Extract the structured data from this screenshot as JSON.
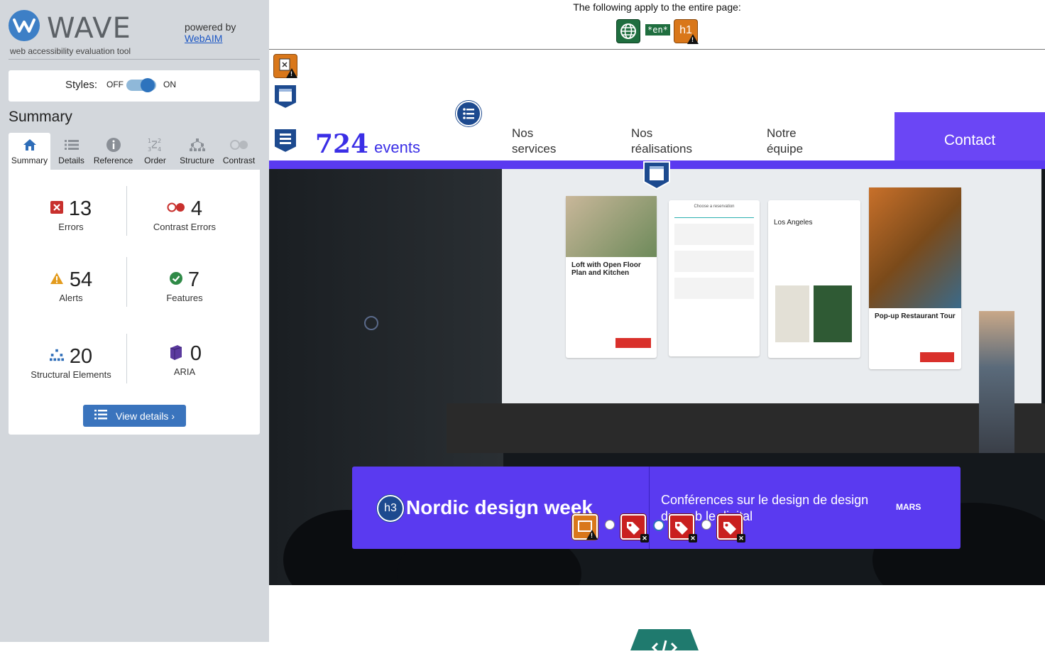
{
  "wave": {
    "brand": "WAVE",
    "subtitle": "web accessibility evaluation tool",
    "powered_by": "powered by",
    "powered_link": "WebAIM",
    "styles_label": "Styles:",
    "styles_off": "OFF",
    "styles_on": "ON",
    "summary_heading": "Summary",
    "tabs": [
      {
        "label": "Summary",
        "icon": "home-icon",
        "active": true
      },
      {
        "label": "Details",
        "icon": "list-icon"
      },
      {
        "label": "Reference",
        "icon": "info-icon"
      },
      {
        "label": "Order",
        "icon": "order-icon"
      },
      {
        "label": "Structure",
        "icon": "structure-icon"
      },
      {
        "label": "Contrast",
        "icon": "contrast-icon"
      }
    ],
    "stats": {
      "errors": {
        "count": "13",
        "label": "Errors",
        "color": "#c8302d"
      },
      "contrast_errors": {
        "count": "4",
        "label": "Contrast Errors",
        "color": "#c8302d"
      },
      "alerts": {
        "count": "54",
        "label": "Alerts",
        "color": "#e39b1d"
      },
      "features": {
        "count": "7",
        "label": "Features",
        "color": "#2f8a47"
      },
      "structural": {
        "count": "20",
        "label": "Structural Elements",
        "color": "#2e6db8"
      },
      "aria": {
        "count": "0",
        "label": "ARIA",
        "color": "#5b3a9e"
      }
    },
    "view_details": "View details ›"
  },
  "page": {
    "topbar_text": "The following apply to the entire page:",
    "lang_code": "*en*",
    "h1_label": "h1",
    "logo_number": "724",
    "logo_word": "events",
    "nav": [
      {
        "line1": "Nos",
        "line2": "services"
      },
      {
        "line1": "Nos",
        "line2": "réalisations"
      },
      {
        "line1": "Notre",
        "line2": "équipe"
      }
    ],
    "contact": "Contact",
    "event": {
      "h3_label": "h3",
      "title": "Nordic design week",
      "description": "Conférences sur le design de design du web le digital",
      "month": "MARS"
    },
    "screen_cards": {
      "card1_title": "Loft with Open Floor Plan and Kitchen",
      "card2_title": "Choose a reservation",
      "card3_title": "Los Angeles",
      "card4_title": "Pop-up Restaurant Tour"
    },
    "colors": {
      "brand_purple": "#5a3af0",
      "contact_purple": "#6b46f5",
      "wave_blue": "#3a74bd"
    }
  }
}
